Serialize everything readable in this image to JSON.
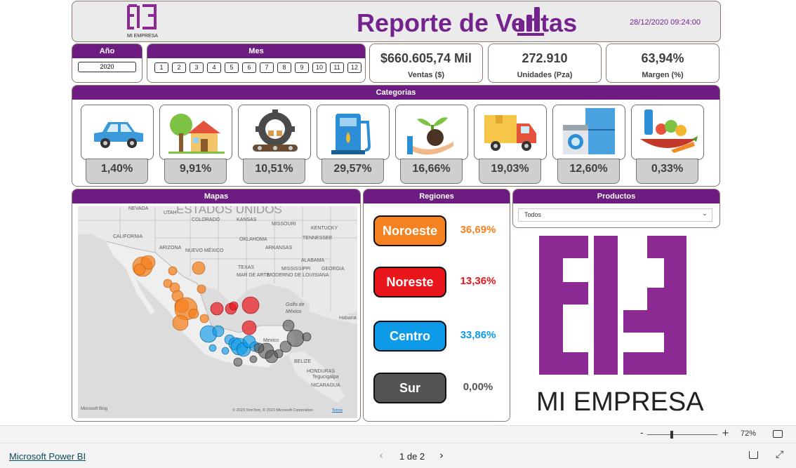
{
  "header": {
    "title": "Reporte de Ventas",
    "datetime": "28/12/2020 09:24:00",
    "logo_small_text": "MI EMPRESA"
  },
  "filters": {
    "year_label": "Año",
    "year_value": "2020",
    "month_label": "Mes",
    "months": [
      "1",
      "2",
      "3",
      "4",
      "5",
      "6",
      "7",
      "8",
      "9",
      "10",
      "11",
      "12"
    ]
  },
  "kpis": [
    {
      "value": "$660.605,74 Mil",
      "label": "Ventas ($)"
    },
    {
      "value": "272.910",
      "label": "Unidades (Pza)"
    },
    {
      "value": "63,94%",
      "label": "Margen (%)"
    }
  ],
  "categories": {
    "title": "Categorias",
    "items": [
      {
        "icon": "car-icon",
        "pct": "1,40%"
      },
      {
        "icon": "house-tree-icon",
        "pct": "9,91%"
      },
      {
        "icon": "factory-gear-icon",
        "pct": "10,51%"
      },
      {
        "icon": "fuel-pump-icon",
        "pct": "29,57%"
      },
      {
        "icon": "plant-hand-icon",
        "pct": "16,66%"
      },
      {
        "icon": "delivery-truck-icon",
        "pct": "19,03%"
      },
      {
        "icon": "appliances-icon",
        "pct": "12,60%"
      },
      {
        "icon": "groceries-icon",
        "pct": "0,33%"
      }
    ]
  },
  "map": {
    "title": "Mapas",
    "country_label": "ESTADOS UNIDOS",
    "labels": [
      "NEVADA",
      "UTAH",
      "COLORADO",
      "KANSAS",
      "MISSOURI",
      "KENTUCKY",
      "CALIFORNIA",
      "OKLAHOMA",
      "TENNESSEE",
      "ARIZONA",
      "NUEVO MÉXICO",
      "ARKANSAS",
      "ALABAMA",
      "TEXAS",
      "MISSISSIPPI",
      "GEORGIA",
      "MAR DE ARTE",
      "MODERNO DE LOUISIANA",
      "Golfo de México",
      "Habana",
      "Mexico",
      "BELIZE",
      "HONDURAS",
      "Tegucigalpa",
      "NICARAGUA"
    ],
    "attribution": "© 2023 TomTom, © 2023 Microsoft Corporation",
    "terms": "Terms",
    "bing": "Microsoft Bing"
  },
  "regions": {
    "title": "Regiones",
    "items": [
      {
        "name": "Noroeste",
        "pct": "36,69%",
        "color": "#f58220"
      },
      {
        "name": "Noreste",
        "pct": "13,36%",
        "color": "#e8161b"
      },
      {
        "name": "Centro",
        "pct": "33,86%",
        "color": "#0d9ae8"
      },
      {
        "name": "Sur",
        "pct": "0,00%",
        "color": "#545454"
      }
    ]
  },
  "products": {
    "title": "Productos",
    "selected": "Todos"
  },
  "big_logo": {
    "text": "MI EMPRESA",
    "color": "#8b2a93"
  },
  "zoom": {
    "minus": "-",
    "plus": "+",
    "value": "72%"
  },
  "footer": {
    "brand_link": "Microsoft Power BI",
    "page_indicator": "1 de 2"
  }
}
